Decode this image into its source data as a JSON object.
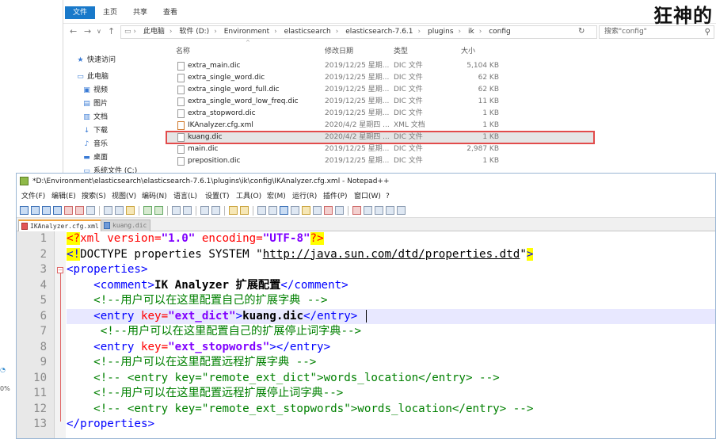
{
  "watermark": "狂神的",
  "explorer": {
    "ribbon_tabs": [
      "文件",
      "主页",
      "共享",
      "查看"
    ],
    "breadcrumbs": [
      "此电脑",
      "软件 (D:)",
      "Environment",
      "elasticsearch",
      "elasticsearch-7.6.1",
      "plugins",
      "ik",
      "config"
    ],
    "search_placeholder": "搜索\"config\"",
    "columns": {
      "name": "名称",
      "date": "修改日期",
      "type": "类型",
      "size": "大小"
    },
    "nav_items": [
      "快速访问",
      "此电脑",
      "视频",
      "图片",
      "文档",
      "下载",
      "音乐",
      "桌面",
      "系统文件 (C:)"
    ],
    "files": [
      {
        "name": "extra_main.dic",
        "date": "2019/12/25 星期...",
        "type": "DIC 文件",
        "size": "5,104 KB"
      },
      {
        "name": "extra_single_word.dic",
        "date": "2019/12/25 星期...",
        "type": "DIC 文件",
        "size": "62 KB"
      },
      {
        "name": "extra_single_word_full.dic",
        "date": "2019/12/25 星期...",
        "type": "DIC 文件",
        "size": "62 KB"
      },
      {
        "name": "extra_single_word_low_freq.dic",
        "date": "2019/12/25 星期...",
        "type": "DIC 文件",
        "size": "11 KB"
      },
      {
        "name": "extra_stopword.dic",
        "date": "2019/12/25 星期...",
        "type": "DIC 文件",
        "size": "1 KB"
      },
      {
        "name": "IKAnalyzer.cfg.xml",
        "date": "2020/4/2 星期四 ...",
        "type": "XML 文档",
        "size": "1 KB"
      },
      {
        "name": "kuang.dic",
        "date": "2020/4/2 星期四 ...",
        "type": "DIC 文件",
        "size": "1 KB"
      },
      {
        "name": "main.dic",
        "date": "2019/12/25 星期...",
        "type": "DIC 文件",
        "size": "2,987 KB"
      },
      {
        "name": "preposition.dic",
        "date": "2019/12/25 星期...",
        "type": "DIC 文件",
        "size": "1 KB"
      }
    ]
  },
  "npp": {
    "title": "*D:\\Environment\\elasticsearch\\elasticsearch-7.6.1\\plugins\\ik\\config\\IKAnalyzer.cfg.xml - Notepad++",
    "menu": [
      "文件(F)",
      "编辑(E)",
      "搜索(S)",
      "视图(V)",
      "编码(N)",
      "语言(L)",
      "设置(T)",
      "工具(O)",
      "宏(M)",
      "运行(R)",
      "插件(P)",
      "窗口(W)",
      "?"
    ],
    "tabs": [
      "IKAnalyzer.cfg.xml",
      "kuang.dic"
    ],
    "line_numbers": [
      "1",
      "2",
      "3",
      "4",
      "5",
      "6",
      "7",
      "8",
      "9",
      "10",
      "11",
      "12",
      "13"
    ],
    "code": {
      "l1": {
        "a": "<?",
        "b": "xml version=",
        "c": "\"1.0\"",
        "d": " encoding=",
        "e": "\"UTF-8\"",
        "f": "?>"
      },
      "l2": {
        "a": "<!",
        "b": "DOCTYPE properties SYSTEM \"",
        "c": "http://java.sun.com/dtd/properties.dtd",
        "d": "\"",
        "e": ">"
      },
      "l3": {
        "a": "<properties>"
      },
      "l4": {
        "indent": "    ",
        "a": "<comment>",
        "b": "IK Analyzer 扩展配置",
        "c": "</comment>"
      },
      "l5": {
        "indent": "    ",
        "a": "<!--用户可以在这里配置自己的扩展字典 -->"
      },
      "l6": {
        "indent": "    ",
        "a": "<entry ",
        "b": "key=",
        "c": "\"ext_dict\"",
        "d": ">",
        "e": "kuang.dic",
        "f": "</entry>"
      },
      "l7": {
        "indent": "     ",
        "a": "<!--用户可以在这里配置自己的扩展停止词字典-->"
      },
      "l8": {
        "indent": "    ",
        "a": "<entry ",
        "b": "key=",
        "c": "\"ext_stopwords\"",
        "d": "></entry>"
      },
      "l9": {
        "indent": "    ",
        "a": "<!--用户可以在这里配置远程扩展字典 -->"
      },
      "l10": {
        "indent": "    ",
        "a": "<!-- <entry key=\"remote_ext_dict\">words_location</entry> -->"
      },
      "l11": {
        "indent": "    ",
        "a": "<!--用户可以在这里配置远程扩展停止词字典-->"
      },
      "l12": {
        "indent": "    ",
        "a": "<!-- <entry key=\"remote_ext_stopwords\">words_location</entry> -->"
      },
      "l13": {
        "a": "</properties>"
      }
    }
  },
  "left_marks": [
    "0%"
  ]
}
